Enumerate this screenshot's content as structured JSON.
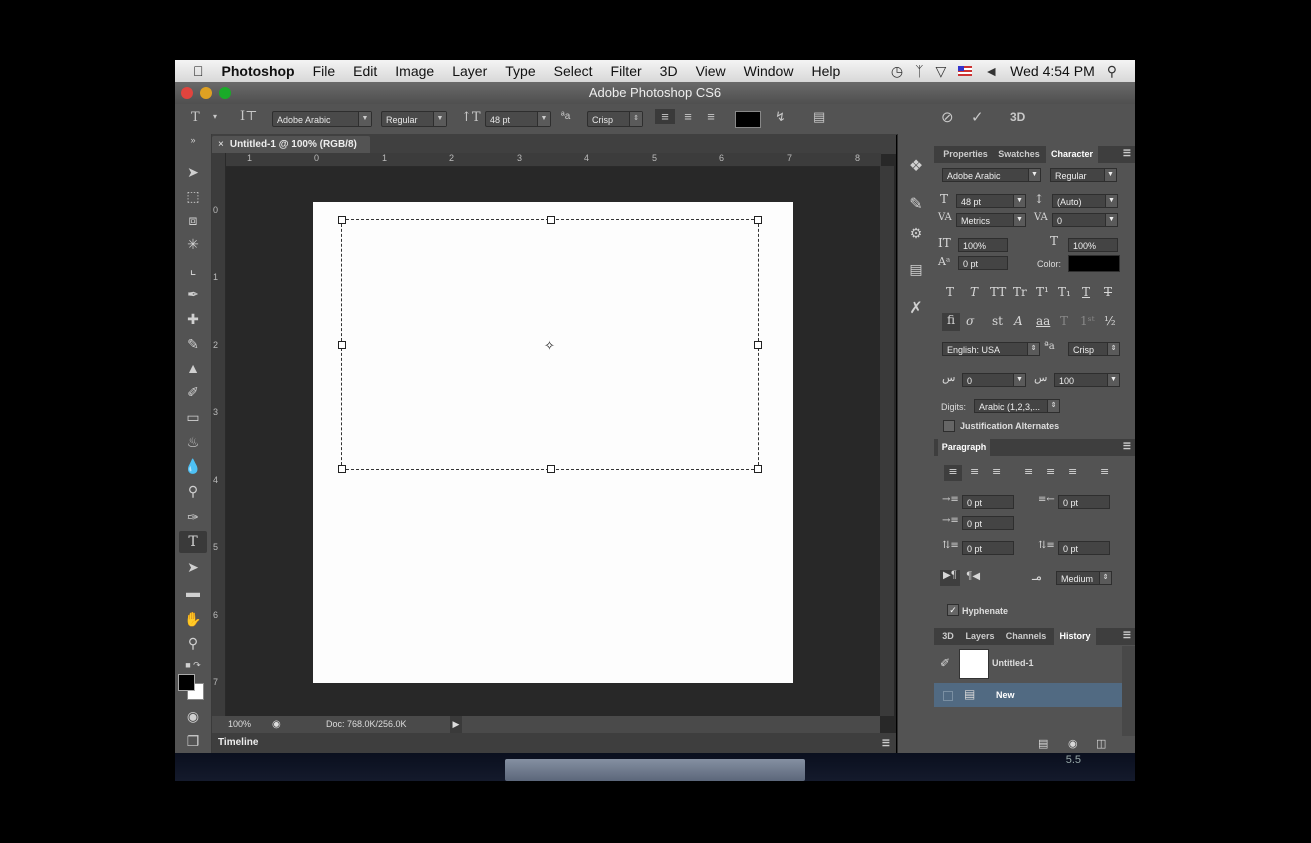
{
  "menubar": {
    "app": "Photoshop",
    "items": [
      "File",
      "Edit",
      "Image",
      "Layer",
      "Type",
      "Select",
      "Filter",
      "3D",
      "View",
      "Window",
      "Help"
    ],
    "clock": "Wed 4:54 PM"
  },
  "window": {
    "title": "Adobe Photoshop CS6"
  },
  "options": {
    "font_family": "Adobe Arabic",
    "font_style": "Regular",
    "font_size": "48 pt",
    "antialias": "Crisp",
    "color": "#000000",
    "threed_label": "3D"
  },
  "document": {
    "tab_title": "Untitled-1 @ 100% (RGB/8)",
    "zoom": "100%",
    "doc_size": "Doc: 768.0K/256.0K",
    "ruler_h": [
      "1",
      "0",
      "1",
      "2",
      "3",
      "4",
      "5",
      "6",
      "7",
      "8"
    ],
    "ruler_v": [
      "0",
      "1",
      "2",
      "3",
      "4",
      "5",
      "6",
      "7"
    ]
  },
  "timeline": {
    "label": "Timeline"
  },
  "character_panel": {
    "tabs": [
      "Properties",
      "Swatches",
      "Character"
    ],
    "font_family": "Adobe Arabic",
    "font_style": "Regular",
    "size": "48 pt",
    "leading": "(Auto)",
    "kerning": "Metrics",
    "tracking": "0",
    "vscale": "100%",
    "hscale": "100%",
    "baseline": "0 pt",
    "color_label": "Color:",
    "language": "English: USA",
    "antialias": "Crisp",
    "kashida_left": "0",
    "kashida_right": "100",
    "digits_label": "Digits:",
    "digits_value": "Arabic (1,2,3,...",
    "justification": "Justification Alternates"
  },
  "paragraph_panel": {
    "title": "Paragraph",
    "indent_left": "0 pt",
    "indent_right": "0 pt",
    "indent_first": "0 pt",
    "space_before": "0 pt",
    "space_after": "0 pt",
    "kashida": "Medium",
    "hyphenate": "Hyphenate"
  },
  "history_panel": {
    "tabs": [
      "3D",
      "Layers",
      "Channels",
      "History"
    ],
    "snapshot": "Untitled-1",
    "state": "New"
  },
  "watermark": "5.5"
}
